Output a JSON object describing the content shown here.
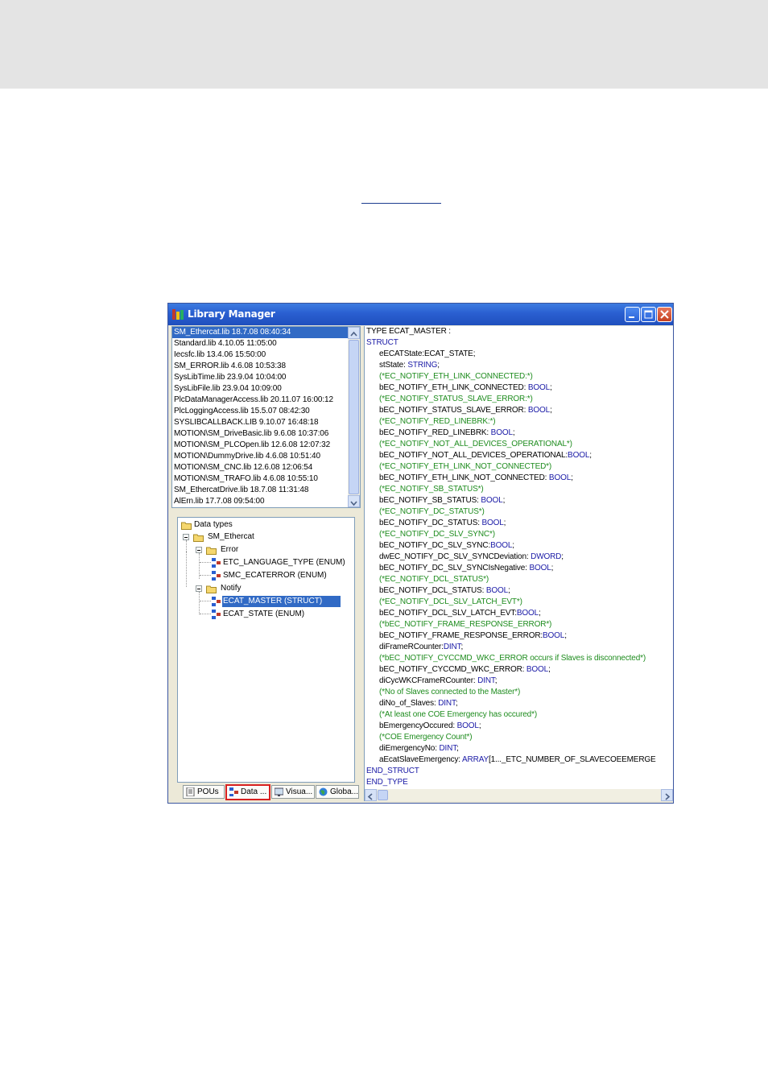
{
  "window": {
    "title": "Library Manager"
  },
  "libraries": [
    "SM_Ethercat.lib 18.7.08 08:40:34",
    "Standard.lib 4.10.05 11:05:00",
    "Iecsfc.lib 13.4.06 15:50:00",
    "SM_ERROR.lib 4.6.08 10:53:38",
    "SysLibTime.lib 23.9.04 10:04:00",
    "SysLibFile.lib 23.9.04 10:09:00",
    "PlcDataManagerAccess.lib 20.11.07 16:00:12",
    "PlcLoggingAccess.lib 15.5.07 08:42:30",
    "SYSLIBCALLBACK.LIB 9.10.07 16:48:18",
    "MOTION\\SM_DriveBasic.lib 9.6.08 10:37:06",
    "MOTION\\SM_PLCOpen.lib 12.6.08 12:07:32",
    "MOTION\\DummyDrive.lib 4.6.08 10:51:40",
    "MOTION\\SM_CNC.lib 12.6.08 12:06:54",
    "MOTION\\SM_TRAFO.lib 4.6.08 10:55:10",
    "SM_EthercatDrive.lib 18.7.08 11:31:48",
    "AlErn.lib 17.7.08 09:54:00"
  ],
  "tree": {
    "root": "Data types",
    "library": "SM_Ethercat",
    "folder_error": "Error",
    "etc_language_type": "ETC_LANGUAGE_TYPE (ENUM)",
    "smc_ecaterror": "SMC_ECATERROR (ENUM)",
    "folder_notify": "Notify",
    "ecat_master": "ECAT_MASTER (STRUCT)",
    "ecat_state": "ECAT_STATE (ENUM)"
  },
  "tabs": {
    "pous": "POUs",
    "data": "Data ...",
    "visu": "Visua...",
    "global": "Globa..."
  },
  "code_lines": [
    {
      "t": "plain",
      "i": 0,
      "text": "TYPE ECAT_MASTER :"
    },
    {
      "t": "kw",
      "i": 0,
      "text": "STRUCT"
    },
    {
      "t": "plain",
      "i": 1,
      "text": "eECATState:ECAT_STATE;"
    },
    {
      "t": "mixed",
      "i": 1,
      "a": "stState: ",
      "b": "STRING",
      "c": ";"
    },
    {
      "t": "cm",
      "i": 1,
      "text": "(*EC_NOTIFY_ETH_LINK_CONNECTED:*)"
    },
    {
      "t": "mixed",
      "i": 1,
      "a": "bEC_NOTIFY_ETH_LINK_CONNECTED: ",
      "b": "BOOL",
      "c": ";"
    },
    {
      "t": "cm",
      "i": 1,
      "text": "(*EC_NOTIFY_STATUS_SLAVE_ERROR:*)"
    },
    {
      "t": "mixed",
      "i": 1,
      "a": "bEC_NOTIFY_STATUS_SLAVE_ERROR: ",
      "b": "BOOL",
      "c": ";"
    },
    {
      "t": "cm",
      "i": 1,
      "text": "(*EC_NOTIFY_RED_LINEBRK:*)"
    },
    {
      "t": "mixed",
      "i": 1,
      "a": "bEC_NOTIFY_RED_LINEBRK: ",
      "b": "BOOL",
      "c": ";"
    },
    {
      "t": "cm",
      "i": 1,
      "text": "(*EC_NOTIFY_NOT_ALL_DEVICES_OPERATIONAL*)"
    },
    {
      "t": "mixed",
      "i": 1,
      "a": "bEC_NOTIFY_NOT_ALL_DEVICES_OPERATIONAL:",
      "b": "BOOL",
      "c": ";"
    },
    {
      "t": "cm",
      "i": 1,
      "text": "(*EC_NOTIFY_ETH_LINK_NOT_CONNECTED*)"
    },
    {
      "t": "mixed",
      "i": 1,
      "a": "bEC_NOTIFY_ETH_LINK_NOT_CONNECTED: ",
      "b": "BOOL",
      "c": ";"
    },
    {
      "t": "cm",
      "i": 1,
      "text": "(*EC_NOTIFY_SB_STATUS*)"
    },
    {
      "t": "mixed",
      "i": 1,
      "a": "bEC_NOTIFY_SB_STATUS: ",
      "b": "BOOL",
      "c": ";"
    },
    {
      "t": "cm",
      "i": 1,
      "text": "(*EC_NOTIFY_DC_STATUS*)"
    },
    {
      "t": "mixed",
      "i": 1,
      "a": "bEC_NOTIFY_DC_STATUS: ",
      "b": "BOOL",
      "c": ";"
    },
    {
      "t": "cm",
      "i": 1,
      "text": "(*EC_NOTIFY_DC_SLV_SYNC*)"
    },
    {
      "t": "mixed",
      "i": 1,
      "a": "bEC_NOTIFY_DC_SLV_SYNC:",
      "b": "BOOL",
      "c": ";"
    },
    {
      "t": "mixed",
      "i": 1,
      "a": "dwEC_NOTIFY_DC_SLV_SYNCDeviation: ",
      "b": "DWORD",
      "c": ";"
    },
    {
      "t": "mixed",
      "i": 1,
      "a": "bEC_NOTIFY_DC_SLV_SYNCIsNegative: ",
      "b": "BOOL",
      "c": ";"
    },
    {
      "t": "cm",
      "i": 1,
      "text": "(*EC_NOTIFY_DCL_STATUS*)"
    },
    {
      "t": "mixed",
      "i": 1,
      "a": "bEC_NOTIFY_DCL_STATUS: ",
      "b": "BOOL",
      "c": ";"
    },
    {
      "t": "cm",
      "i": 1,
      "text": "(*EC_NOTIFY_DCL_SLV_LATCH_EVT*)"
    },
    {
      "t": "mixed",
      "i": 1,
      "a": "bEC_NOTIFY_DCL_SLV_LATCH_EVT:",
      "b": "BOOL",
      "c": ";"
    },
    {
      "t": "cm",
      "i": 1,
      "text": "(*bEC_NOTIFY_FRAME_RESPONSE_ERROR*)"
    },
    {
      "t": "mixed",
      "i": 1,
      "a": "bEC_NOTIFY_FRAME_RESPONSE_ERROR:",
      "b": "BOOL",
      "c": ";"
    },
    {
      "t": "mixed",
      "i": 1,
      "a": "diFrameRCounter:",
      "b": "DINT",
      "c": ";"
    },
    {
      "t": "cm",
      "i": 1,
      "text": "(*bEC_NOTIFY_CYCCMD_WKC_ERROR occurs if Slaves is disconnected*)"
    },
    {
      "t": "mixed",
      "i": 1,
      "a": "bEC_NOTIFY_CYCCMD_WKC_ERROR: ",
      "b": "BOOL",
      "c": ";"
    },
    {
      "t": "mixed",
      "i": 1,
      "a": "diCycWKCFrameRCounter: ",
      "b": "DINT",
      "c": ";"
    },
    {
      "t": "cm",
      "i": 1,
      "text": "(*No of Slaves connected to the Master*)"
    },
    {
      "t": "mixed",
      "i": 1,
      "a": "diNo_of_Slaves: ",
      "b": "DINT",
      "c": ";"
    },
    {
      "t": "cm",
      "i": 1,
      "text": "(*At least one COE Emergency has occured*)"
    },
    {
      "t": "mixed",
      "i": 1,
      "a": "bEmergencyOccured: ",
      "b": "BOOL",
      "c": ";"
    },
    {
      "t": "cm",
      "i": 1,
      "text": "(*COE Emergency Count*)"
    },
    {
      "t": "mixed",
      "i": 1,
      "a": "diEmergencyNo: ",
      "b": "DINT",
      "c": ";"
    },
    {
      "t": "mixed",
      "i": 1,
      "a": "aEcatSlaveEmergency: ",
      "b": "ARRAY",
      "c": "[1..._ETC_NUMBER_OF_SLAVECOEEMERGE"
    },
    {
      "t": "kw",
      "i": 0,
      "text": "END_STRUCT"
    },
    {
      "t": "kw",
      "i": 0,
      "text": "END_TYPE"
    }
  ],
  "colors": {
    "selection": "#316ac5",
    "keyword": "#1a1aa6",
    "comment": "#1e8c1e",
    "active_tab_border": "#d82020"
  },
  "icons": [
    "library-manager-icon",
    "minimize-icon",
    "maximize-icon",
    "close-icon",
    "folder-open-icon",
    "datatype-icon",
    "pous-icon",
    "datatypes-icon",
    "visualization-icon",
    "globe-icon",
    "scroll-up-icon",
    "scroll-down-icon",
    "scroll-left-icon",
    "scroll-right-icon"
  ]
}
